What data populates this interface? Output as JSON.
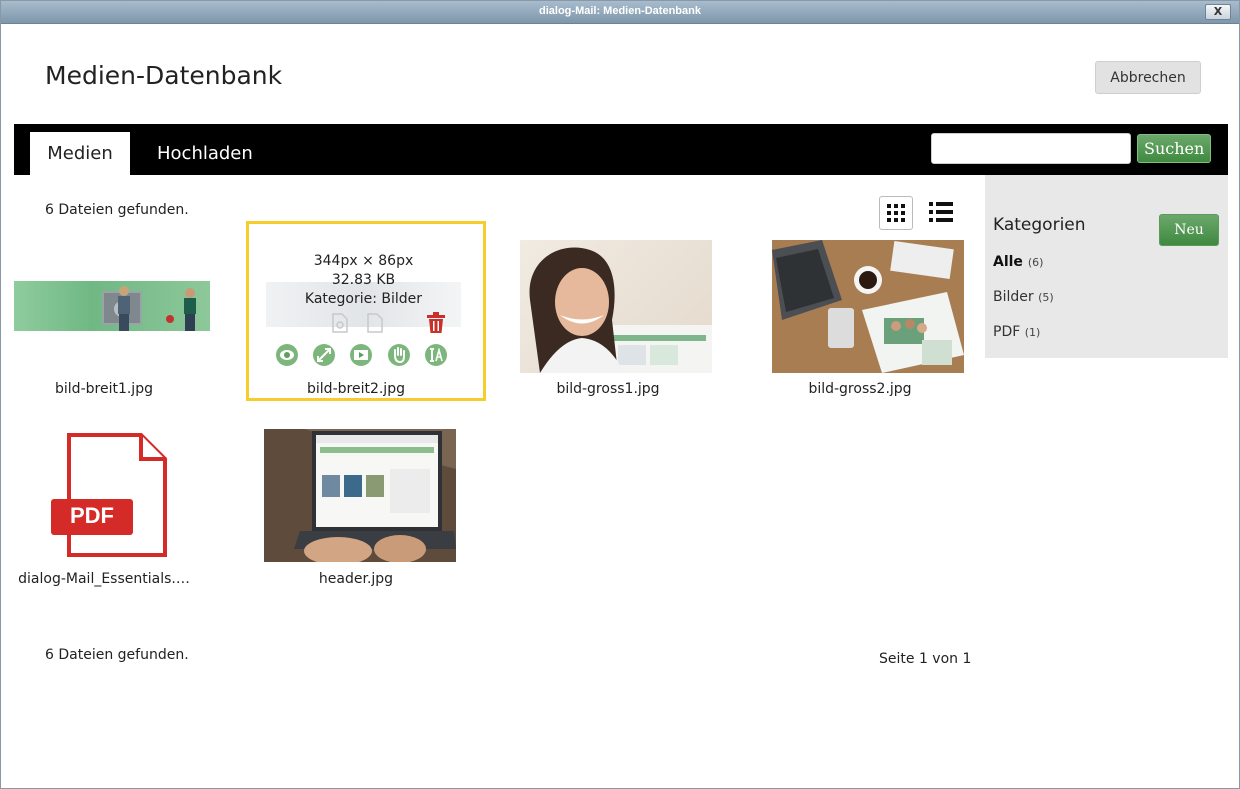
{
  "window": {
    "title": "dialog-Mail: Medien-Datenbank",
    "close_label": "X"
  },
  "header": {
    "title": "Medien-Datenbank",
    "cancel_label": "Abbrechen"
  },
  "tabs": [
    {
      "label": "Medien"
    },
    {
      "label": "Hochladen"
    }
  ],
  "search": {
    "placeholder": "",
    "value": "",
    "button_label": "Suchen"
  },
  "results": {
    "top_count": "6 Dateien gefunden.",
    "bottom_count": "6 Dateien gefunden.",
    "pager": "Seite 1 von 1"
  },
  "view_modes": [
    {
      "icon": "grid-view-icon",
      "active": true
    },
    {
      "icon": "list-view-icon",
      "active": false
    }
  ],
  "categories": {
    "heading": "Kategorien",
    "new_label": "Neu",
    "items": [
      {
        "label": "Alle",
        "count": "(6)"
      },
      {
        "label": "Bilder",
        "count": "(5)"
      },
      {
        "label": "PDF",
        "count": "(1)"
      }
    ]
  },
  "media": [
    {
      "filename": "bild-breit1.jpg"
    },
    {
      "filename": "bild-breit2.jpg",
      "info": {
        "dimensions": "344px × 86px",
        "size": "32.83 KB",
        "category": "Kategorie: Bilder"
      }
    },
    {
      "filename": "bild-gross1.jpg"
    },
    {
      "filename": "bild-gross2.jpg"
    },
    {
      "filename": "dialog-Mail_Essentials.…",
      "badge": "PDF"
    },
    {
      "filename": "header.jpg"
    }
  ],
  "colors": {
    "accent_green": "#4a9a4a",
    "selection_yellow": "#f7cd2c",
    "navbar": "#000000",
    "delete_red": "#c8312b"
  }
}
